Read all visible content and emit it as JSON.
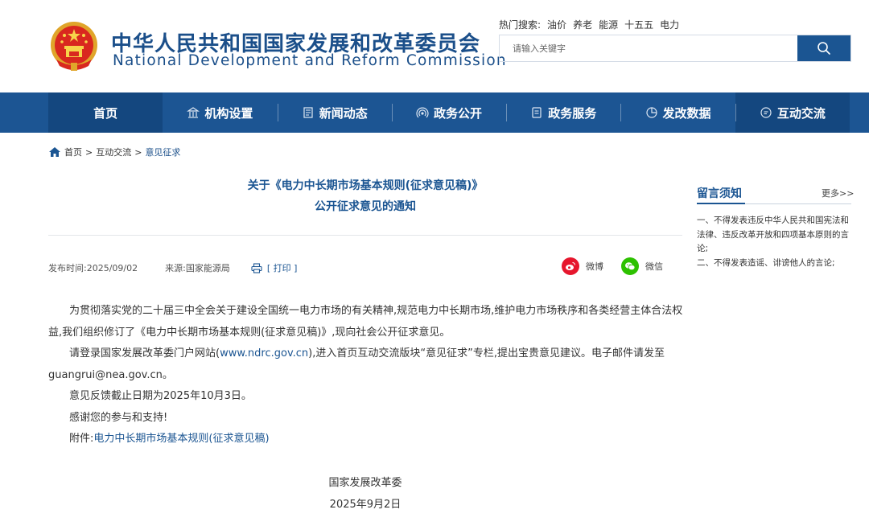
{
  "header": {
    "title_cn": "中华人民共和国国家发展和改革委员会",
    "title_en": "National Development and Reform Commission",
    "hot_label": "热门搜索:",
    "hot_terms": [
      "油价",
      "养老",
      "能源",
      "十五五",
      "电力"
    ],
    "search_placeholder": "请输入关键字"
  },
  "nav": {
    "items": [
      {
        "label": "首页",
        "icon": "none"
      },
      {
        "label": "机构设置",
        "icon": "building-icon"
      },
      {
        "label": "新闻动态",
        "icon": "newspaper-icon"
      },
      {
        "label": "政务公开",
        "icon": "broadcast-icon"
      },
      {
        "label": "政务服务",
        "icon": "document-icon"
      },
      {
        "label": "发改数据",
        "icon": "pie-chart-icon"
      },
      {
        "label": "互动交流",
        "icon": "chat-icon"
      }
    ]
  },
  "breadcrumb": {
    "items": [
      "首页",
      "互动交流",
      "意见征求"
    ],
    "separator": ">"
  },
  "article": {
    "title_line1": "关于《电力中长期市场基本规则(征求意见稿)》",
    "title_line2": "公开征求意见的通知",
    "publish_label": "发布时间:2025/09/02",
    "source_label": "来源:国家能源局",
    "print_label": "[ 打印 ]",
    "share_weibo": "微博",
    "share_wechat": "微信",
    "para1": "为贯彻落实党的二十届三中全会关于建设全国统一电力市场的有关精神,规范电力中长期市场,维护电力市场秩序和各类经营主体合法权益,我们组织修订了《电力中长期市场基本规则(征求意见稿)》,现向社会公开征求意见。",
    "para2_a": "请登录国家发展改革委门户网站(",
    "para2_link": "www.ndrc.gov.cn",
    "para2_b": "),进入首页互动交流版块“意见征求”专栏,提出宝贵意见建议。电子邮件请发至guangrui@nea.gov.cn。",
    "para3": "意见反馈截止日期为2025年10月3日。",
    "para4": "感谢您的参与和支持!",
    "attach_label": "附件:",
    "attach_link": "电力中长期市场基本规则(征求意见稿)",
    "sign_org": "国家发展改革委",
    "sign_date": "2025年9月2日"
  },
  "sidebar": {
    "title": "留言须知",
    "more": "更多>>",
    "rule1": "一、不得发表违反中华人民共和国宪法和法律、违反改革开放和四项基本原则的言论;",
    "rule2": "二、不得发表造谣、诽谤他人的言论;"
  },
  "colors": {
    "brand_blue": "#1c5593",
    "nav_active": "#14477f",
    "weibo_red": "#e6162d",
    "wechat_green": "#2dc100"
  }
}
